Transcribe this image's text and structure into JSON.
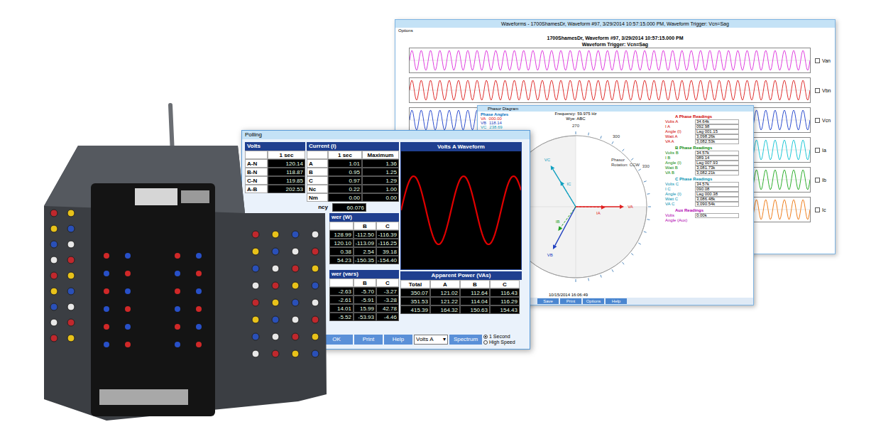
{
  "waveforms_window": {
    "title": "Waveforms - 1700ShamesDr, Waveform #97, 3/29/2014 10:57:15.000 PM, Waveform Trigger: Vcn=Sag",
    "menu": [
      "Options"
    ],
    "header": [
      "1700ShamesDr, Waveform #97, 3/29/2014 10:57:15.000 PM",
      "Waveform Trigger: Vcn=Sag"
    ],
    "channels": [
      {
        "name": "Van",
        "color": "#e040e0",
        "checked": false
      },
      {
        "name": "Vbn",
        "color": "#e03030",
        "checked": false
      },
      {
        "name": "Vcn",
        "color": "#3050d0",
        "checked": false
      },
      {
        "name": "Ia",
        "color": "#20c8d8",
        "checked": false
      },
      {
        "name": "Ib",
        "color": "#30b030",
        "checked": false
      },
      {
        "name": "Ic",
        "color": "#f08020",
        "checked": false
      }
    ]
  },
  "phasor_window": {
    "title": "Phasor Diagram",
    "phase_angles": {
      "title": "Phase Angles",
      "rows": [
        {
          "label": "VA",
          "value": "000.00",
          "color": "#e02020"
        },
        {
          "label": "VB",
          "value": "118.14",
          "color": "#2040c0"
        },
        {
          "label": "VC",
          "value": "238.69",
          "color": "#10a0c0"
        }
      ]
    },
    "frequency": "Frequency: 59.975 Hz",
    "wiring": "Wye: ABC",
    "rotation": [
      "Phasor",
      "Rotation: CCW"
    ],
    "dial_labels": [
      {
        "text": "270",
        "angle": 270
      },
      {
        "text": "300",
        "angle": 300
      },
      {
        "text": "330",
        "angle": 330
      }
    ],
    "vectors": [
      {
        "label": "VA",
        "angle": 0,
        "length": 0.68,
        "color": "#e02020",
        "kind": "voltage"
      },
      {
        "label": "VB",
        "angle": 118.14,
        "length": 0.68,
        "color": "#2040c0",
        "kind": "voltage"
      },
      {
        "label": "VC",
        "angle": 238.69,
        "length": 0.68,
        "color": "#10a0c0",
        "kind": "voltage"
      },
      {
        "label": "IA",
        "angle": 1.15,
        "length": 0.42,
        "color": "#e02020",
        "kind": "current"
      },
      {
        "label": "IB",
        "angle": 126.07,
        "length": 0.42,
        "color": "#20a020",
        "kind": "current"
      },
      {
        "label": "IC",
        "angle": 239.07,
        "length": 0.42,
        "color": "#10a0c0",
        "kind": "current"
      }
    ],
    "readings": [
      {
        "title": "A Phase Readings",
        "color": "#d00000",
        "rows": [
          {
            "label": "Volts A",
            "value": "34.64k"
          },
          {
            "label": "I A",
            "value": "092.98"
          },
          {
            "label": "Angle (I)",
            "value": "Lag 001.15"
          },
          {
            "label": "Watt A",
            "value": "3,098.26k"
          },
          {
            "label": "VA A",
            "value": "3,082.53k"
          }
        ]
      },
      {
        "title": "B Phase Readings",
        "color": "#0a8a0a",
        "rows": [
          {
            "label": "Volts B",
            "value": "34.57k"
          },
          {
            "label": "I B",
            "value": "089.14"
          },
          {
            "label": "Angle (I)",
            "value": "Lag 007.93"
          },
          {
            "label": "Watt B",
            "value": "3,081.73k"
          },
          {
            "label": "VA B",
            "value": "3,082.21k"
          }
        ]
      },
      {
        "title": "C Phase Readings",
        "color": "#0090b0",
        "rows": [
          {
            "label": "Volts C",
            "value": "34.57k"
          },
          {
            "label": "I C",
            "value": "090.08"
          },
          {
            "label": "Angle (I)",
            "value": "Lag 000.38"
          },
          {
            "label": "Watt C",
            "value": "3,086.48k"
          },
          {
            "label": "VA C",
            "value": "3,090.54k"
          }
        ]
      },
      {
        "title": "Aux Readings",
        "color": "#b000b0",
        "rows": [
          {
            "label": "Volts",
            "value": "0.00k"
          },
          {
            "label": "Angle (Aux)"
          }
        ]
      }
    ],
    "timestamp": "10/15/2014 16:06:49",
    "buttons": [
      "Save",
      "Print",
      "Options",
      "Help"
    ]
  },
  "polling_window": {
    "title": "Polling",
    "volts": {
      "title": "Volts",
      "columns": [
        "1 sec"
      ],
      "rows": [
        {
          "label": "A-N",
          "values": [
            "120.14"
          ]
        },
        {
          "label": "B-N",
          "values": [
            "118.87"
          ]
        },
        {
          "label": "C-N",
          "values": [
            "119.85"
          ]
        },
        {
          "label": "A-B",
          "values": [
            "202.53"
          ]
        }
      ]
    },
    "current": {
      "title": "Current (I)",
      "columns": [
        "1 sec",
        "Maximum"
      ],
      "rows": [
        {
          "label": "A",
          "values": [
            "1.01",
            "1.36"
          ]
        },
        {
          "label": "B",
          "values": [
            "0.95",
            "1.25"
          ]
        },
        {
          "label": "C",
          "values": [
            "0.97",
            "1.29"
          ]
        },
        {
          "label": "Nc",
          "values": [
            "0.22",
            "1.00"
          ]
        },
        {
          "label": "Nm",
          "values": [
            "0.00",
            "0.00"
          ]
        }
      ]
    },
    "frequency": {
      "label": "ncy",
      "value": "60.076"
    },
    "power_w": {
      "title": "wer (W)",
      "columns": [
        "B",
        "C"
      ],
      "rows": [
        [
          "128.99",
          "-112.50",
          "-116.39"
        ],
        [
          "120.10",
          "-113.09",
          "-116.25"
        ],
        [
          "0.38",
          "2.54",
          "39.18"
        ],
        [
          "54.23",
          "-150.35",
          "-154.40"
        ]
      ]
    },
    "power_vars": {
      "title": "wer (vars)",
      "columns": [
        "B",
        "C"
      ],
      "rows": [
        [
          "-2.63",
          "-5.70",
          "-3.27"
        ],
        [
          "-2.61",
          "-5.91",
          "-3.28"
        ],
        [
          "14.01",
          "15.99",
          "42.78"
        ],
        [
          "-5.52",
          "-53.93",
          "-4.46"
        ]
      ]
    },
    "waveform": {
      "title": "Volts A Waveform"
    },
    "apparent_power": {
      "title": "Apparent Power (VAs)",
      "columns": [
        "Total",
        "A",
        "B",
        "C"
      ],
      "rows": [
        [
          "350.07",
          "121.02",
          "112.64",
          "116.43"
        ],
        [
          "351.53",
          "121.22",
          "114.04",
          "116.29"
        ],
        [
          "415.39",
          "164.32",
          "150.63",
          "154.43"
        ]
      ]
    },
    "buttons": [
      "OK",
      "Print",
      "Help"
    ],
    "channel_select": {
      "value": "Volts A",
      "arrow": "▾"
    },
    "spectrum_button": "Spectrum",
    "rate": [
      {
        "label": "1 Second",
        "selected": true
      },
      {
        "label": "High Speed",
        "selected": false
      }
    ]
  }
}
